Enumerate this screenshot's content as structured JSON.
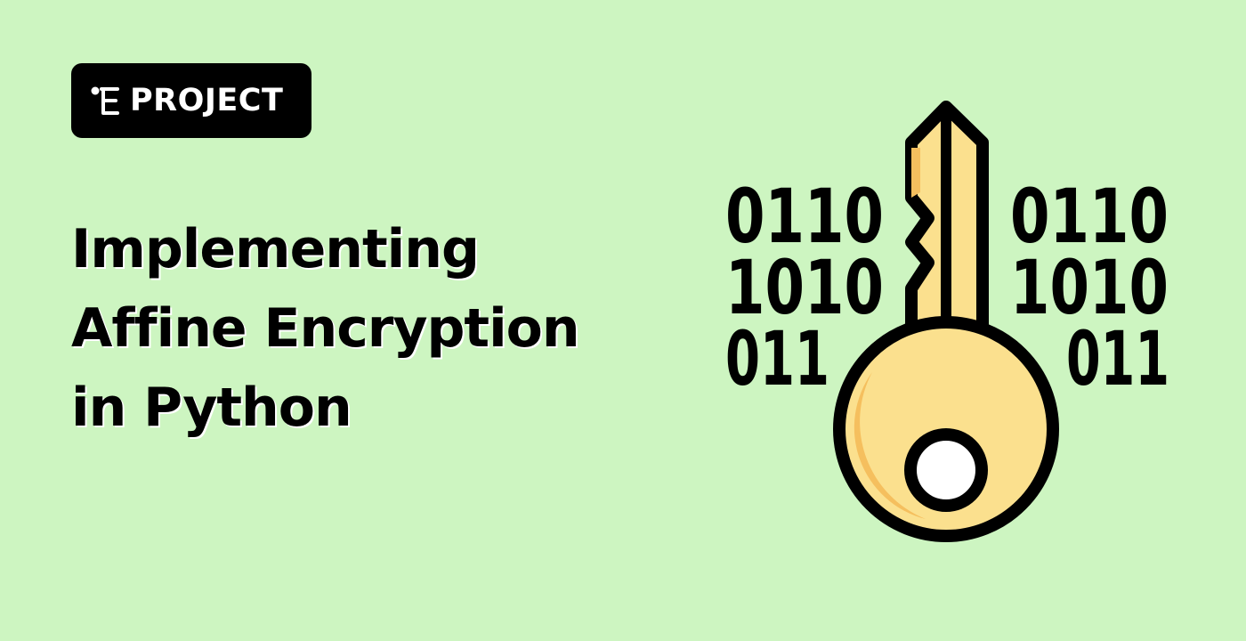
{
  "badge": {
    "label": "PROJECT",
    "icon": "tree-icon"
  },
  "title": {
    "lines": [
      "Implementing",
      "Affine Encryption",
      "in Python"
    ]
  },
  "illustration": {
    "icon": "key-icon",
    "binary_left": [
      "0110",
      "1010",
      "011"
    ],
    "binary_right": [
      "0110",
      "1010",
      "011"
    ]
  },
  "colors": {
    "background": "#cdf5c1",
    "badge": "#000000",
    "key_fill": "#fbe08e",
    "key_shadow": "#f5bf5e",
    "outline": "#000000"
  }
}
